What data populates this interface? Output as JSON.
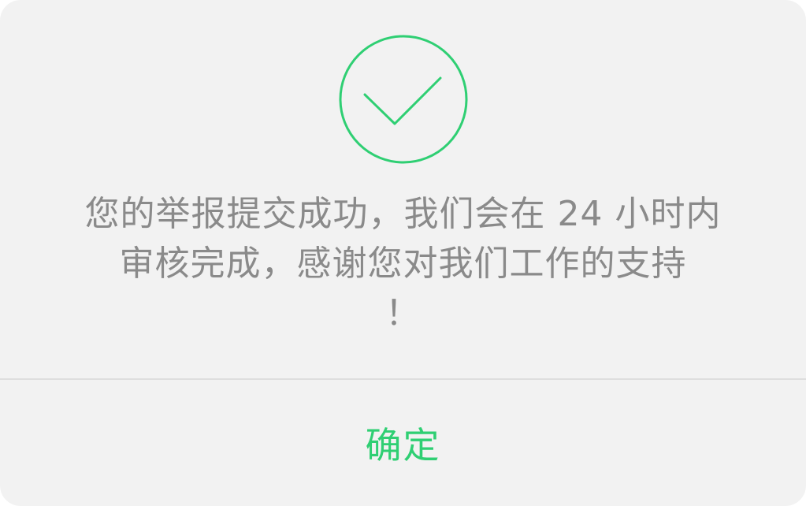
{
  "dialog": {
    "icon": "check-circle-icon",
    "accent_color": "#2fcf73",
    "message_lines": [
      "您的举报提交成功，我们会在 24 小时内审核完成，感谢您对我们工作的支持！"
    ],
    "confirm_label": "确定"
  }
}
